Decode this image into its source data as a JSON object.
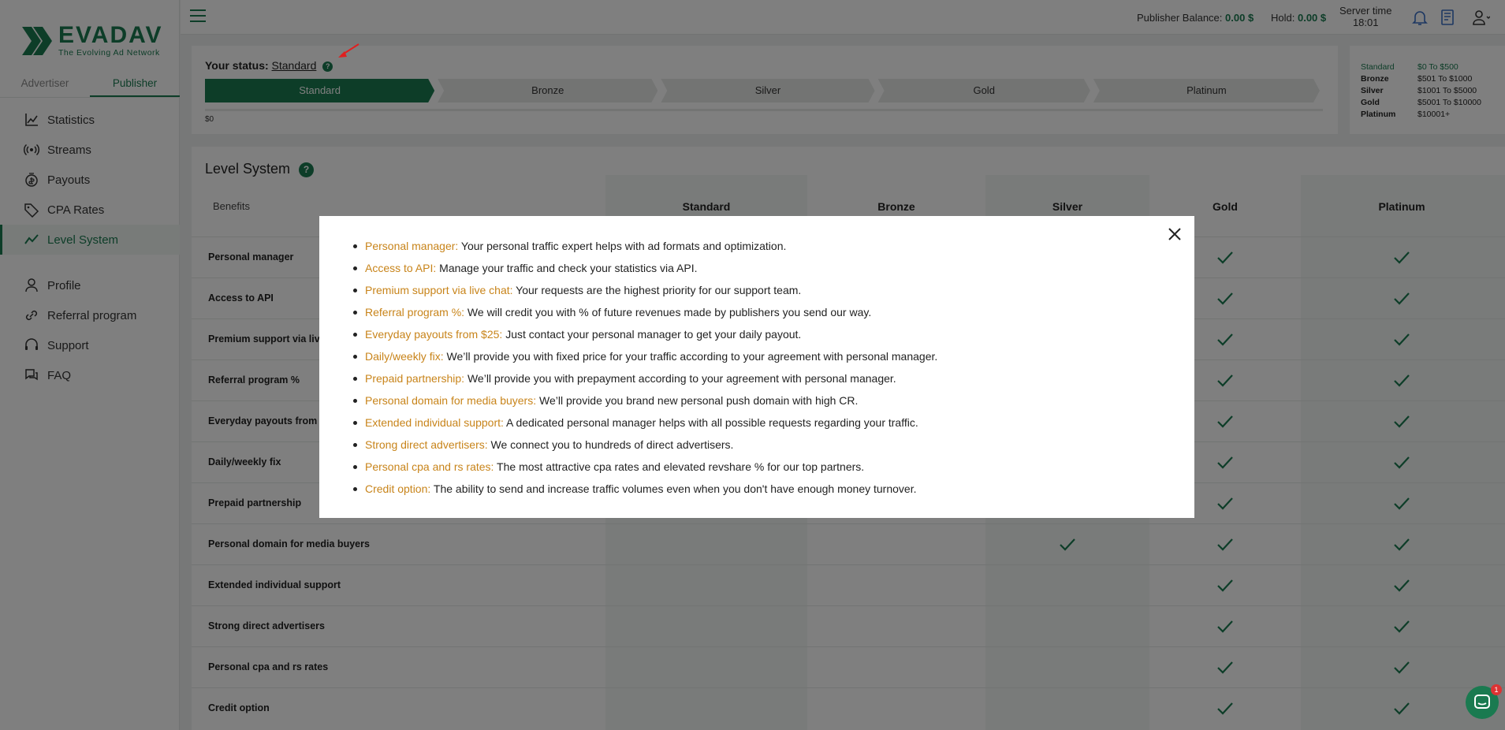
{
  "brand": {
    "name": "EVADAV",
    "tagline": "The Evolving Ad Network",
    "color": "#1a7a50"
  },
  "role_tabs": [
    {
      "label": "Advertiser"
    },
    {
      "label": "Publisher"
    }
  ],
  "nav": {
    "items": [
      {
        "label": "Statistics",
        "icon": "chart-icon"
      },
      {
        "label": "Streams",
        "icon": "broadcast-icon"
      },
      {
        "label": "Payouts",
        "icon": "coin-icon"
      },
      {
        "label": "CPA Rates",
        "icon": "tag-icon"
      },
      {
        "label": "Level System",
        "icon": "trend-icon"
      }
    ],
    "secondary": [
      {
        "label": "Profile",
        "icon": "user-icon"
      },
      {
        "label": "Referral program",
        "icon": "link-icon"
      },
      {
        "label": "Support",
        "icon": "headset-icon"
      },
      {
        "label": "FAQ",
        "icon": "faq-icon"
      }
    ]
  },
  "topbar": {
    "balance_label": "Publisher Balance:",
    "balance_value": "0.00 $",
    "hold_label": "Hold:",
    "hold_value": "0.00 $",
    "server_label": "Server time",
    "server_time": "18:01"
  },
  "status": {
    "label": "Your status:",
    "value": "Standard",
    "help": "?",
    "steps": [
      "Standard",
      "Bronze",
      "Silver",
      "Gold",
      "Platinum"
    ],
    "active_step": 0,
    "start_amount": "$0"
  },
  "ranges": [
    {
      "name": "Standard",
      "range": "$0 To $500"
    },
    {
      "name": "Bronze",
      "range": "$501 To $1000"
    },
    {
      "name": "Silver",
      "range": "$1001 To $5000"
    },
    {
      "name": "Gold",
      "range": "$5001 To $10000"
    },
    {
      "name": "Platinum",
      "range": "$10001+"
    }
  ],
  "level_system": {
    "title": "Level System",
    "help": "?",
    "benefits_header": "Benefits",
    "columns": [
      "Standard",
      "Bronze",
      "Silver",
      "Gold",
      "Platinum"
    ],
    "rows": [
      {
        "label": "Personal manager",
        "checks": [
          false,
          false,
          false,
          true,
          true
        ]
      },
      {
        "label": "Access to API",
        "checks": [
          false,
          false,
          false,
          true,
          true
        ]
      },
      {
        "label": "Premium support via live chat",
        "checks": [
          false,
          false,
          false,
          true,
          true
        ]
      },
      {
        "label": "Referral program %",
        "checks": [
          false,
          false,
          false,
          true,
          true
        ]
      },
      {
        "label": "Everyday payouts from $25",
        "checks": [
          false,
          false,
          false,
          true,
          true
        ]
      },
      {
        "label": "Daily/weekly fix",
        "checks": [
          false,
          false,
          false,
          true,
          true
        ]
      },
      {
        "label": "Prepaid partnership",
        "checks": [
          false,
          false,
          false,
          true,
          true
        ]
      },
      {
        "label": "Personal domain for media buyers",
        "checks": [
          false,
          false,
          true,
          true,
          true
        ]
      },
      {
        "label": "Extended individual support",
        "checks": [
          false,
          false,
          false,
          true,
          true
        ]
      },
      {
        "label": "Strong direct advertisers",
        "checks": [
          false,
          false,
          false,
          true,
          true
        ]
      },
      {
        "label": "Personal cpa and rs rates",
        "checks": [
          false,
          false,
          false,
          true,
          true
        ]
      },
      {
        "label": "Credit option",
        "checks": [
          false,
          false,
          false,
          true,
          true
        ]
      }
    ]
  },
  "modal": {
    "items": [
      {
        "key": "Personal manager:",
        "text": " Your personal traffic expert helps with ad formats and optimization."
      },
      {
        "key": "Access to API:",
        "text": " Manage your traffic and check your statistics via API."
      },
      {
        "key": "Premium support via live chat:",
        "text": " Your requests are the highest priority for our support team."
      },
      {
        "key": "Referral program %:",
        "text": " We will credit you with % of future revenues made by publishers you send our way."
      },
      {
        "key": "Everyday payouts from $25:",
        "text": " Just contact your personal manager to get your daily payout."
      },
      {
        "key": "Daily/weekly fix:",
        "text": " We’ll provide you with fixed price for your traffic according to your agreement with personal manager."
      },
      {
        "key": "Prepaid partnership:",
        "text": " We’ll provide you with prepayment according to your agreement with personal manager."
      },
      {
        "key": "Personal domain for media buyers:",
        "text": " We’ll provide you brand new personal push domain with high CR."
      },
      {
        "key": "Extended individual support:",
        "text": " A dedicated personal manager helps with all possible requests regarding your traffic."
      },
      {
        "key": "Strong direct advertisers:",
        "text": " We connect you to hundreds of direct advertisers."
      },
      {
        "key": "Personal cpa and rs rates:",
        "text": " The most attractive cpa rates and elevated revshare % for our top partners."
      },
      {
        "key": "Credit option:",
        "text": " The ability to send and increase traffic volumes even when you don't have enough money turnover."
      }
    ]
  },
  "chat_badge": "1"
}
